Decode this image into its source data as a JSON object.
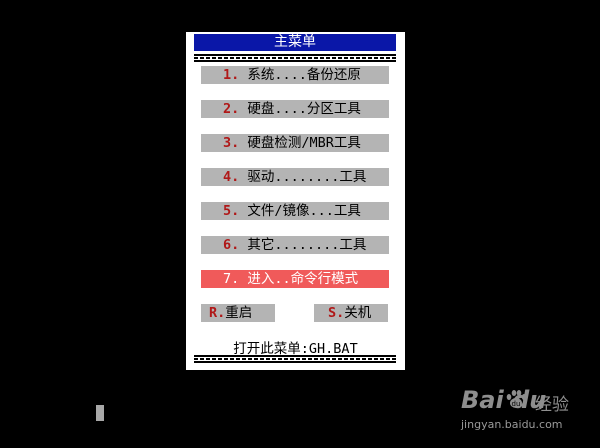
{
  "menu": {
    "title": "主菜单",
    "items": [
      {
        "key": "1.",
        "label": " 系统....备份还原",
        "selected": false
      },
      {
        "key": "2.",
        "label": " 硬盘....分区工具",
        "selected": false
      },
      {
        "key": "3.",
        "label": " 硬盘检测/MBR工具",
        "selected": false
      },
      {
        "key": "4.",
        "label": " 驱动........工具",
        "selected": false
      },
      {
        "key": "5.",
        "label": " 文件/镜像...工具",
        "selected": false
      },
      {
        "key": "6.",
        "label": " 其它........工具",
        "selected": false
      },
      {
        "key": "7.",
        "label": " 进入..命令行模式",
        "selected": true
      }
    ],
    "reboot": {
      "key": "R.",
      "label": "重启"
    },
    "shutdown": {
      "key": "S.",
      "label": "关机"
    },
    "footer": "打开此菜单:GH.BAT"
  },
  "watermark": {
    "logo": "Bai  du",
    "brand": "经验",
    "url": "jingyan.baidu.com"
  },
  "colors": {
    "title_bar": "#0a17a8",
    "menu_item_bg": "#b4b4b4",
    "selected_bg": "#f05a5a",
    "hotkey": "#b01818",
    "background": "#000000"
  }
}
